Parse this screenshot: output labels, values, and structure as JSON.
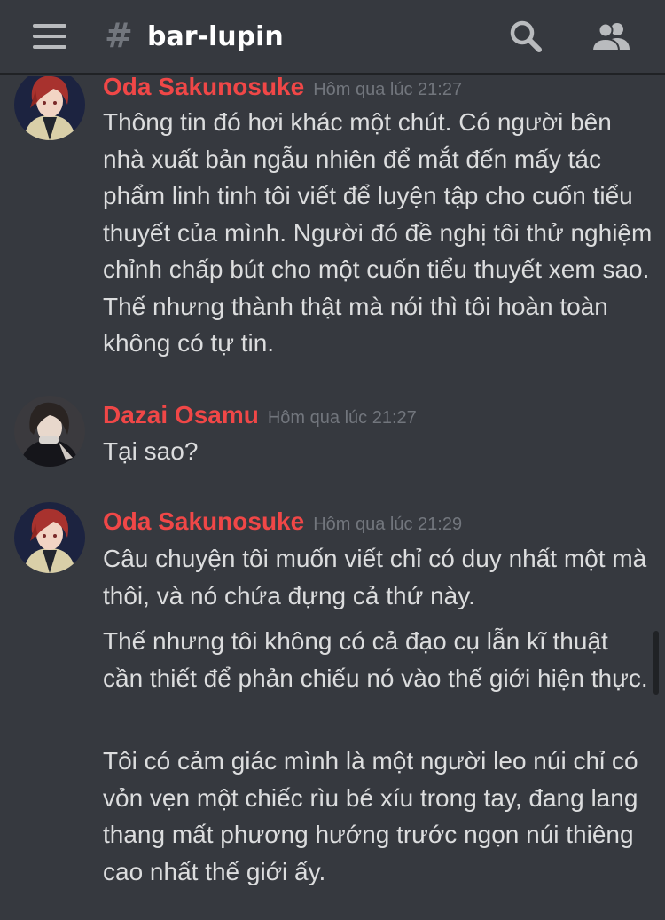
{
  "header": {
    "channel_hash": "#",
    "channel_name": "bar-lupin"
  },
  "icons": {
    "menu": "hamburger-menu-icon",
    "search": "search-icon",
    "members": "members-icon"
  },
  "colors": {
    "background": "#36393f",
    "author_name": "#f04747",
    "timestamp": "#72767d",
    "text": "#dcddde"
  },
  "messages": [
    {
      "author": "Oda Sakunosuke",
      "timestamp": "Hôm qua lúc 21:27",
      "paragraphs": [
        "Thông tin đó hơi khác một chút. Có người bên nhà xuất bản ngẫu nhiên để mắt đến mấy tác phẩm linh tinh tôi viết để luyện tập cho cuốn tiểu thuyết của mình. Người đó đề nghị tôi thử nghiệm chỉnh chấp bút cho một cuốn tiểu thuyết xem sao. Thế nhưng thành thật mà nói thì tôi hoàn toàn không có tự tin."
      ]
    },
    {
      "author": "Dazai Osamu",
      "timestamp": "Hôm qua lúc 21:27",
      "paragraphs": [
        "Tại sao?"
      ]
    },
    {
      "author": "Oda Sakunosuke",
      "timestamp": "Hôm qua lúc 21:29",
      "paragraphs": [
        "Câu chuyện tôi muốn viết chỉ có duy nhất một mà thôi, và nó chứa đựng cả thứ này.",
        "Thế nhưng tôi không có cả đạo cụ lẫn kĩ thuật cần thiết để phản chiếu nó vào thế giới hiện thực.",
        "Tôi có cảm giác mình là một người leo núi chỉ có vỏn vẹn một chiếc rìu bé xíu trong tay, đang lang thang mất phương hướng trước ngọn núi thiêng cao nhất thế giới ấy."
      ]
    }
  ]
}
